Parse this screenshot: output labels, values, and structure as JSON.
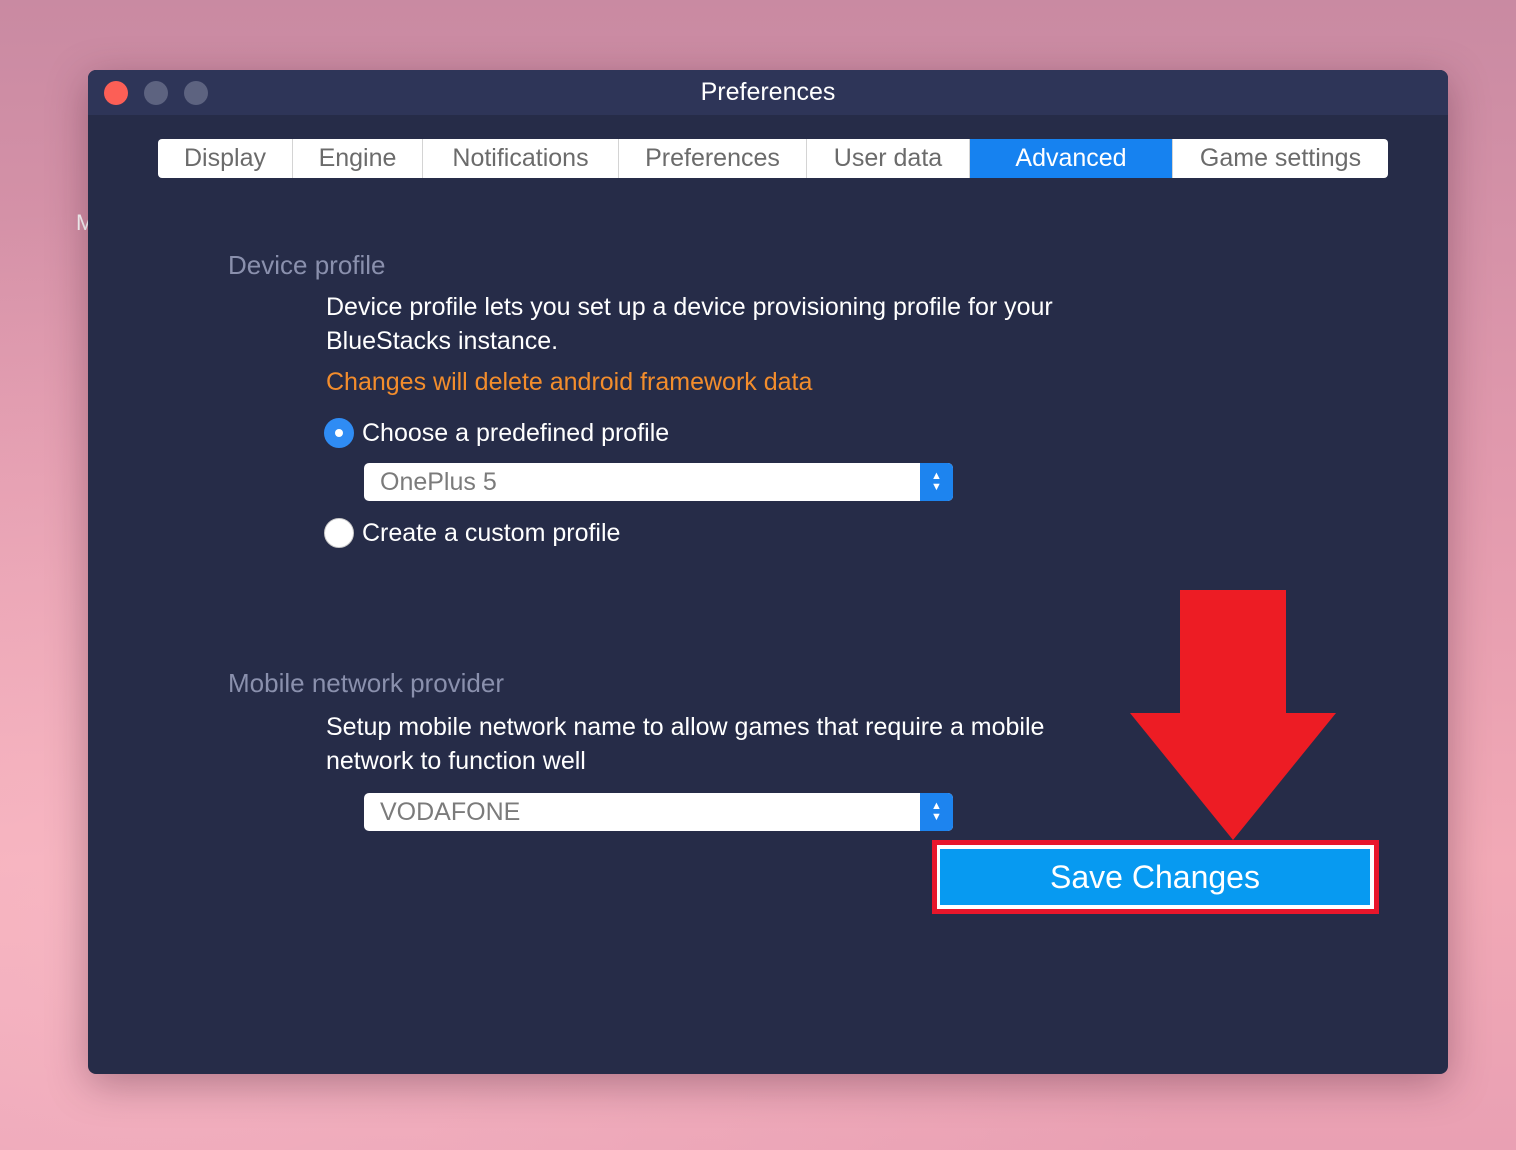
{
  "desktop": {
    "edge_letter": "M"
  },
  "window": {
    "title": "Preferences"
  },
  "tabs": [
    {
      "label": "Display",
      "active": false
    },
    {
      "label": "Engine",
      "active": false
    },
    {
      "label": "Notifications",
      "active": false
    },
    {
      "label": "Preferences",
      "active": false
    },
    {
      "label": "User data",
      "active": false
    },
    {
      "label": "Advanced",
      "active": true
    },
    {
      "label": "Game settings",
      "active": false
    }
  ],
  "device_profile": {
    "title": "Device profile",
    "description": "Device profile lets you set up a device provisioning profile for your BlueStacks instance.",
    "warning": "Changes will delete android framework data",
    "options": [
      {
        "label": "Choose a predefined profile",
        "checked": true
      },
      {
        "label": "Create a custom profile",
        "checked": false
      }
    ],
    "selected_profile": "OnePlus 5"
  },
  "mobile_network": {
    "title": "Mobile network provider",
    "description": "Setup mobile network name to allow games that require a mobile network to function well",
    "selected_provider": "VODAFONE"
  },
  "save_button": {
    "label": "Save Changes"
  },
  "colors": {
    "window_bg": "#262c48",
    "titlebar_bg": "#2e3558",
    "active_tab": "#1682f0",
    "warning": "#f38d2c",
    "save_button": "#079af1",
    "highlight_red": "#e8162b"
  },
  "icons": {
    "select_stepper": "up-down-chevron-icon",
    "annotation": "red-down-arrow"
  }
}
